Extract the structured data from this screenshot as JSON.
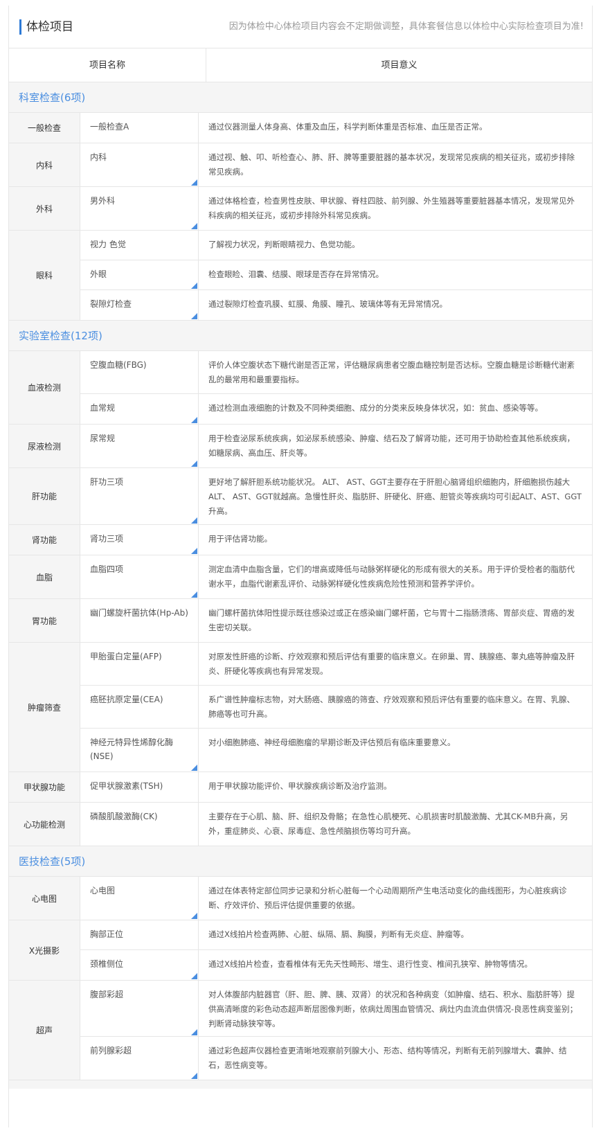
{
  "header": {
    "title": "体检项目",
    "notice": "因为体检中心体检项目内容会不定期做调整，具体套餐信息以体检中心实际检查项目为准!"
  },
  "columns": {
    "name": "项目名称",
    "meaning": "项目意义"
  },
  "sections": [
    {
      "title": "科室检查(6项)",
      "groups": [
        {
          "name": "一般检查",
          "items": [
            {
              "name": "一般检查A",
              "meaning": "通过仪器测量人体身高、体重及血压，科学判断体重是否标准、血压是否正常。",
              "flag": false,
              "h": 43
            }
          ]
        },
        {
          "name": "内科",
          "items": [
            {
              "name": "内科",
              "meaning": "通过视、触、叩、听检查心、肺、肝、脾等重要脏器的基本状况，发现常见疾病的相关征兆，或初步排除常见疾病。",
              "flag": true,
              "h": 62
            }
          ]
        },
        {
          "name": "外科",
          "items": [
            {
              "name": "男外科",
              "meaning": "通过体格检查，检查男性皮肤、甲状腺、脊柱四肢、前列腺、外生殖器等重要脏器基本情况，发现常见外科疾病的相关征兆，或初步排除外科常见疾病。",
              "flag": true,
              "h": 62
            }
          ]
        },
        {
          "name": "眼科",
          "items": [
            {
              "name": "视力 色觉",
              "meaning": "了解视力状况，判断眼睛视力、色觉功能。",
              "flag": false,
              "h": 43
            },
            {
              "name": "外眼",
              "meaning": "检查眼睑、泪囊、结膜、眼球是否存在异常情况。",
              "flag": true,
              "h": 43
            },
            {
              "name": "裂隙灯检查",
              "meaning": "通过裂隙灯检查巩膜、虹膜、角膜、瞳孔、玻璃体等有无异常情况。",
              "flag": true,
              "h": 43
            }
          ]
        }
      ]
    },
    {
      "title": "实验室检查(12项)",
      "groups": [
        {
          "name": "血液检测",
          "items": [
            {
              "name": "空腹血糖(FBG)",
              "meaning": "评价人体空腹状态下糖代谢是否正常，评估糖尿病患者空腹血糖控制是否达标。空腹血糖是诊断糖代谢紊乱的最常用和最重要指标。",
              "flag": false,
              "h": 62
            },
            {
              "name": "血常规",
              "meaning": "通过检测血液细胞的计数及不同种类细胞、成分的分类来反映身体状况，如：贫血、感染等等。",
              "flag": true,
              "h": 43
            }
          ]
        },
        {
          "name": "尿液检测",
          "items": [
            {
              "name": "尿常规",
              "meaning": "用于检查泌尿系统疾病，如泌尿系统感染、肿瘤、结石及了解肾功能，还可用于协助检查其他系统疾病，如糖尿病、高血压、肝炎等。",
              "flag": true,
              "h": 62
            }
          ]
        },
        {
          "name": "肝功能",
          "items": [
            {
              "name": "肝功三项",
              "meaning": "更好地了解肝胆系统功能状况。 ALT、 AST、GGT主要存在于肝胆心脑肾组织细胞内，肝细胞损伤越大ALT、 AST、GGT就越高。急慢性肝炎、脂肪肝、肝硬化、肝癌、胆管炎等疾病均可引起ALT、AST、GGT升高。",
              "flag": true,
              "h": 81
            }
          ]
        },
        {
          "name": "肾功能",
          "items": [
            {
              "name": "肾功三项",
              "meaning": "用于评估肾功能。",
              "flag": true,
              "h": 43
            }
          ]
        },
        {
          "name": "血脂",
          "items": [
            {
              "name": "血脂四项",
              "meaning": "测定血清中血脂含量，它们的增高或降低与动脉粥样硬化的形成有很大的关系。用于评价受检者的脂肪代谢水平，血脂代谢紊乱评价、动脉粥样硬化性疾病危险性预测和营养学评价。",
              "flag": true,
              "h": 62
            }
          ]
        },
        {
          "name": "胃功能",
          "items": [
            {
              "name": "幽门螺旋杆菌抗体(Hp-Ab)",
              "meaning": "幽门螺杆菌抗体阳性提示既往感染过或正在感染幽门螺杆菌，它与胃十二指肠溃疡、胃部炎症、胃癌的发生密切关联。",
              "flag": false,
              "h": 62
            }
          ]
        },
        {
          "name": "肿瘤筛查",
          "items": [
            {
              "name": "甲胎蛋白定量(AFP)",
              "meaning": "对原发性肝癌的诊断、疗效观察和预后评估有重要的临床意义。在卵巢、胃、胰腺癌、睾丸癌等肿瘤及肝炎、肝硬化等疾病也有异常发现。",
              "flag": false,
              "h": 62
            },
            {
              "name": "癌胚抗原定量(CEA)",
              "meaning": "系广谱性肿瘤标志物，对大肠癌、胰腺癌的筛查、疗效观察和预后评估有重要的临床意义。在胃、乳腺、肺癌等也可升高。",
              "flag": false,
              "h": 62
            },
            {
              "name": "神经元特异性烯醇化酶(NSE)",
              "meaning": "对小细胞肺癌、神经母细胞瘤的早期诊断及评估预后有临床重要意义。",
              "flag": true,
              "h": 62
            }
          ]
        },
        {
          "name": "甲状腺功能",
          "items": [
            {
              "name": "促甲状腺激素(TSH)",
              "meaning": "用于甲状腺功能评价、甲状腺疾病诊断及治疗监测。",
              "flag": false,
              "h": 43
            }
          ]
        },
        {
          "name": "心功能检测",
          "items": [
            {
              "name": "磷酸肌酸激酶(CK)",
              "meaning": "主要存在于心肌、脑、肝、组织及骨骼；在急性心肌梗死、心肌损害时肌酸激酶、尤其CK-MB升高，另外，重症肺炎、心衰、尿毒症、急性颅脑损伤等均可升高。",
              "flag": false,
              "h": 62
            }
          ]
        }
      ]
    },
    {
      "title": "医技检查(5项)",
      "groups": [
        {
          "name": "心电图",
          "items": [
            {
              "name": "心电图",
              "meaning": "通过在体表特定部位同步记录和分析心脏每一个心动周期所产生电活动变化的曲线图形，为心脏疾病诊断、疗效评价、预后评估提供重要的依据。",
              "flag": true,
              "h": 62
            }
          ]
        },
        {
          "name": "X光摄影",
          "items": [
            {
              "name": "胸部正位",
              "meaning": "通过X线拍片检查两肺、心脏、纵隔、膈、胸膜，判断有无炎症、肿瘤等。",
              "flag": false,
              "h": 43
            },
            {
              "name": "颈椎侧位",
              "meaning": "通过X线拍片检查，查看椎体有无先天性畸形、增生、退行性变、椎间孔狭窄、肿物等情况。",
              "flag": true,
              "h": 43
            }
          ]
        },
        {
          "name": "超声",
          "items": [
            {
              "name": "腹部彩超",
              "meaning": "对人体腹部内脏器官（肝、胆、脾、胰、双肾）的状况和各种病变（如肿瘤、结石、积水、脂肪肝等）提供高清晰度的彩色动态超声断层图像判断，依病灶周围血管情况、病灶内血流血供情况-良恶性病变鉴别；判断肾动脉狭窄等。",
              "flag": true,
              "h": 81
            },
            {
              "name": "前列腺彩超",
              "meaning": "通过彩色超声仪器检查更清晰地观察前列腺大小、形态、结构等情况，判断有无前列腺增大、囊肿、结石，恶性病变等。",
              "flag": true,
              "h": 62
            }
          ]
        }
      ]
    }
  ]
}
